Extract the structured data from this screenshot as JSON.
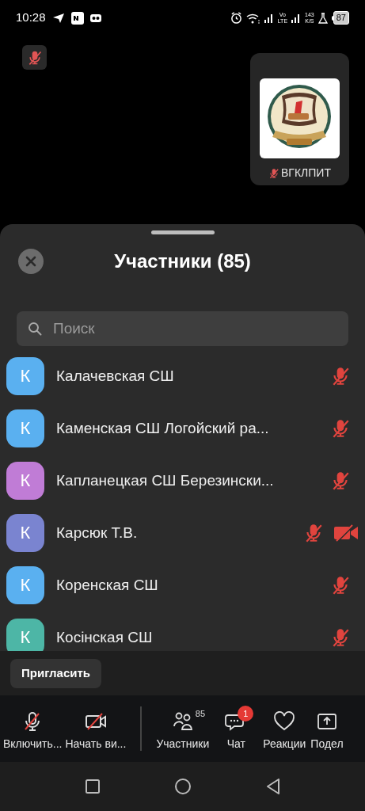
{
  "status_bar": {
    "time": "10:28",
    "network_type": "Vo LTE",
    "speed": "143 K/S",
    "battery": "87"
  },
  "self_view": {
    "mic_muted": true
  },
  "video_tile": {
    "kind": "picture",
    "name": "ВГКЛПИТ",
    "mic_muted": true
  },
  "participants_sheet": {
    "title": "Участники (85)",
    "search": {
      "placeholder": "Поиск"
    },
    "participants": [
      {
        "initial": "К",
        "name": "Калачевская СШ",
        "color": "#5ab0f0",
        "mic_muted": true,
        "video_muted": false
      },
      {
        "initial": "К",
        "name": "Каменская СШ Логойский ра...",
        "color": "#5ab0f0",
        "mic_muted": true,
        "video_muted": false
      },
      {
        "initial": "К",
        "name": "Капланецкая СШ Березински...",
        "color": "#c07cd6",
        "mic_muted": true,
        "video_muted": false
      },
      {
        "initial": "К",
        "name": "Карсюк Т.В.",
        "color": "#7a84d0",
        "mic_muted": true,
        "video_muted": true
      },
      {
        "initial": "К",
        "name": "Коренская СШ",
        "color": "#5ab0f0",
        "mic_muted": true,
        "video_muted": false
      },
      {
        "initial": "К",
        "name": "Косінская СШ",
        "color": "#4db6a6",
        "mic_muted": true,
        "video_muted": false
      }
    ],
    "invite_button": "Пригласить"
  },
  "toolbar": [
    {
      "kind": "mic",
      "label": "Включить..."
    },
    {
      "kind": "video",
      "label": "Начать ви..."
    },
    {
      "kind": "separator"
    },
    {
      "kind": "participants",
      "label": "Участники",
      "count": "85"
    },
    {
      "kind": "chat",
      "label": "Чат",
      "badge": "1"
    },
    {
      "kind": "reactions",
      "label": "Реакции"
    },
    {
      "kind": "share",
      "label": "Подел"
    }
  ]
}
